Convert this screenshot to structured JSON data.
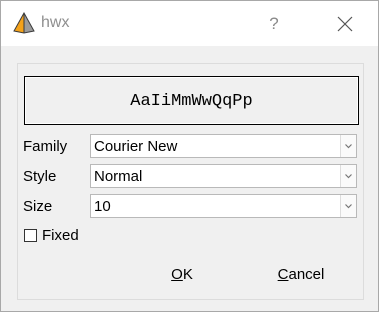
{
  "window": {
    "title": "hwx",
    "help_label": "?"
  },
  "preview": {
    "sample_text": "AaIiMmWwQqPp"
  },
  "fields": {
    "family": {
      "label": "Family",
      "value": "Courier New"
    },
    "style": {
      "label": "Style",
      "value": "Normal"
    },
    "size": {
      "label": "Size",
      "value": "10"
    }
  },
  "fixed": {
    "label": "Fixed",
    "checked": false
  },
  "buttons": {
    "ok_mnemonic": "O",
    "ok_rest": "K",
    "cancel_mnemonic": "C",
    "cancel_rest": "ancel"
  },
  "icons": {
    "app": "pyramid-app-icon",
    "close": "close-icon",
    "dropdown": "chevron-down-icon",
    "checkbox": "checkbox-unchecked-icon"
  }
}
